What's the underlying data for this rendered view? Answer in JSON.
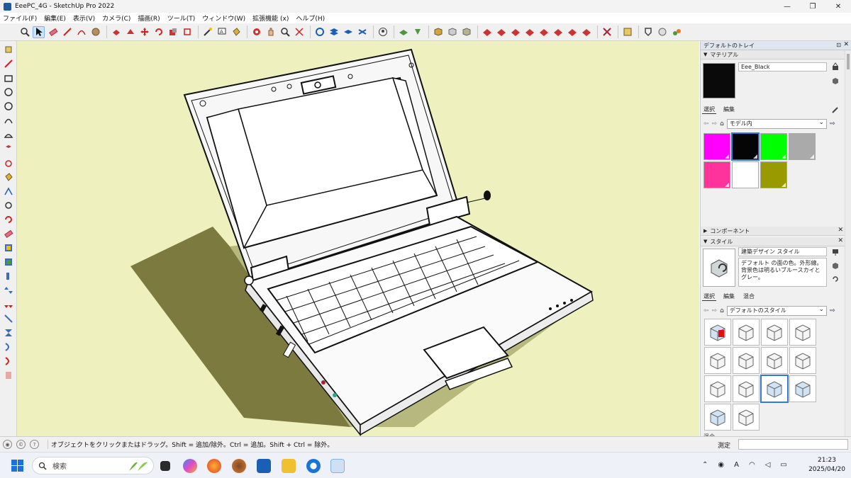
{
  "window": {
    "title": "EeePC_4G - SketchUp Pro 2022",
    "minimize": "—",
    "maximize": "❐",
    "close": "✕"
  },
  "menu": [
    "ファイル(F)",
    "編集(E)",
    "表示(V)",
    "カメラ(C)",
    "描画(R)",
    "ツール(T)",
    "ウィンドウ(W)",
    "拡張機能 (x)",
    "ヘルプ(H)"
  ],
  "tray": {
    "title": "デフォルトのトレイ",
    "materials": {
      "header": "マテリアル",
      "current_name": "Eee_Black",
      "current_color": "#0a0a0a",
      "tabs": [
        "選択",
        "編集"
      ],
      "library": "モデル内",
      "swatches": [
        "#ff00ff",
        "#050505",
        "#00ff00",
        "#aaaaaa",
        "#ff3399",
        "#ffffff",
        "#999900"
      ],
      "selected_index": 1
    },
    "components": {
      "header": "コンポーネント"
    },
    "styles": {
      "header": "スタイル",
      "current_name": "建築デザイン スタイル",
      "description": "デフォルト の面の色。外形線。背景色は明るいブルースカイとグレー。",
      "tabs": [
        "選択",
        "編集",
        "混合"
      ],
      "library": "デフォルトのスタイル",
      "thumb_count": 14,
      "selected_index": 10
    },
    "bottom_cut_label": "混合"
  },
  "status": {
    "message": "オブジェクトをクリックまたはドラッグ。Shift = 追加/除外。Ctrl = 追加。Shift + Ctrl = 除外。",
    "measure_label": "測定",
    "measure_value": ""
  },
  "taskbar": {
    "search_placeholder": "検索",
    "time": "21:23",
    "date": "2025/04/20",
    "ime": "A"
  },
  "colors": {
    "viewport_bg": "#eef1bd",
    "shadow": "#7c7a3e",
    "accent": "#3479d6"
  }
}
